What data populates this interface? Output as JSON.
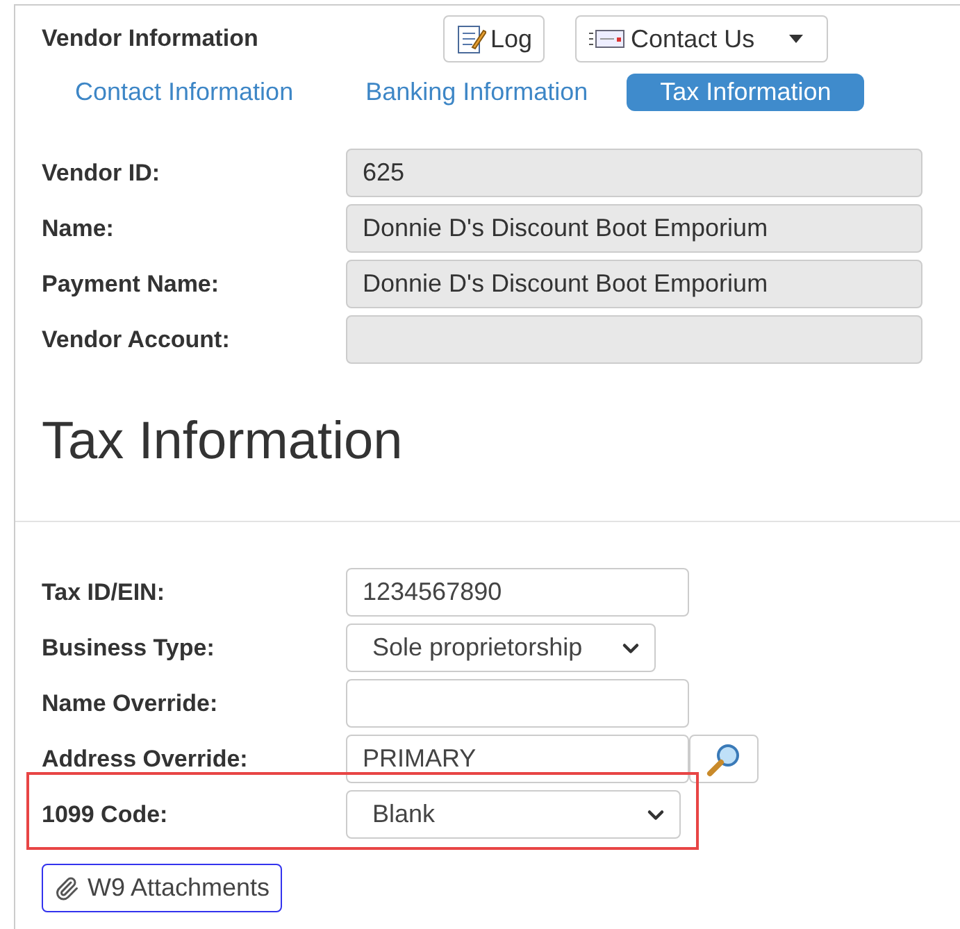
{
  "header": {
    "title": "Vendor Information",
    "buttons": [
      {
        "label": "Log",
        "kind": "log"
      },
      {
        "label": "Contact Us",
        "kind": "contact"
      }
    ]
  },
  "tabs": [
    {
      "label": "Contact Information",
      "selected": false
    },
    {
      "label": "Banking Information",
      "selected": false
    },
    {
      "label": "Tax Information",
      "selected": true
    }
  ],
  "vendor_fields": [
    {
      "label": "Vendor ID:",
      "value": "625"
    },
    {
      "label": "Name:",
      "value": "Donnie D's Discount Boot Emporium"
    },
    {
      "label": "Payment Name:",
      "value": "Donnie D's Discount Boot Emporium"
    },
    {
      "label": "Vendor Account:"
    }
  ],
  "section_title": "Tax Information",
  "tax_fields": [
    {
      "label": "Tax ID/EIN:",
      "kind": "text",
      "value": "1234567890",
      "highlighted": false
    },
    {
      "label": "Business Type:",
      "kind": "select",
      "value": "Sole proprietorship",
      "highlighted": false
    },
    {
      "label": "Name Override:",
      "kind": "text",
      "highlighted": false
    },
    {
      "label": "Address Override:",
      "kind": "lookup",
      "value": "PRIMARY",
      "highlighted": false
    },
    {
      "label": "1099 Code:",
      "kind": "select",
      "value": "Blank",
      "highlighted": true
    }
  ],
  "attachments_button": "W9 Attachments"
}
